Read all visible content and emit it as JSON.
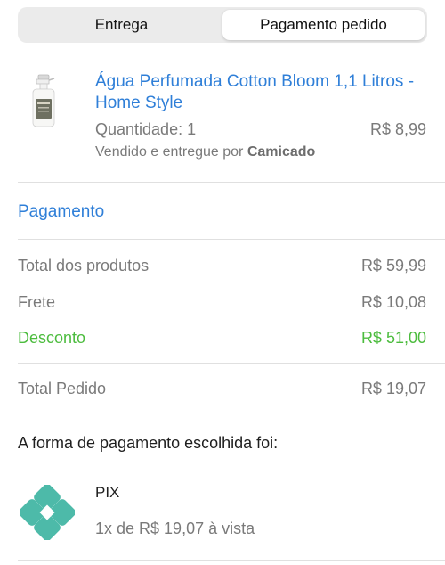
{
  "tabs": [
    {
      "label": "Entrega",
      "active": false
    },
    {
      "label": "Pagamento pedido",
      "active": true
    }
  ],
  "product": {
    "name": "Água Perfumada Cotton Bloom 1,1 Litros - Home Style",
    "quantity": "Quantidade: 1",
    "price": "R$ 8,99",
    "seller_prefix": "Vendido e entregue por",
    "seller_name": "Camicado",
    "thumbnail_icon": "perfume-spray-bottle"
  },
  "payment_section": {
    "title": "Pagamento",
    "rows": [
      {
        "label": "Total dos produtos",
        "value": "R$ 59,99"
      },
      {
        "label": "Frete",
        "value": "R$ 10,08"
      },
      {
        "label": "Desconto",
        "value": "R$ 51,00"
      }
    ],
    "total": {
      "label": "Total Pedido",
      "value": "R$ 19,07"
    }
  },
  "payment_method": {
    "heading": "A forma de pagamento escolhida foi:",
    "name": "PIX",
    "installments": "1x de R$ 19,07 à vista",
    "icon": "pix-icon"
  },
  "colors": {
    "link_blue": "#2f7fd8",
    "discount_green": "#4cbc3e",
    "muted_gray": "#7a7a7a",
    "pix_teal": "#4dbaa9"
  }
}
